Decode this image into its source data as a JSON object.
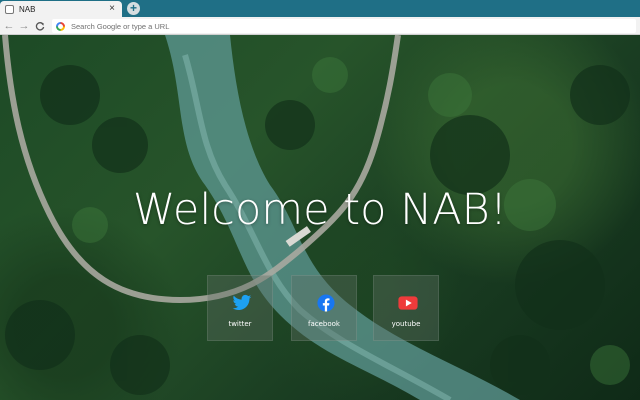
{
  "browser": {
    "tab_title": "NAB",
    "tab_close": "×",
    "new_tab": "+",
    "omnibox_placeholder": "Search Google or type a URL",
    "nav": {
      "back": "←",
      "forward": "→",
      "reload": "C"
    }
  },
  "page": {
    "heading": "Welcome to NAB!",
    "shortcuts": [
      {
        "label": "twitter",
        "icon": "twitter-icon",
        "color": "#1da1f2"
      },
      {
        "label": "facebook",
        "icon": "facebook-icon",
        "color": "#1877f2"
      },
      {
        "label": "youtube",
        "icon": "youtube-icon",
        "color": "#ee3b3b"
      }
    ]
  },
  "colors": {
    "tabstrip": "#1f6f86",
    "toolbar": "#f2f2f2",
    "tile_overlay": "rgba(95,110,100,0.38)"
  }
}
